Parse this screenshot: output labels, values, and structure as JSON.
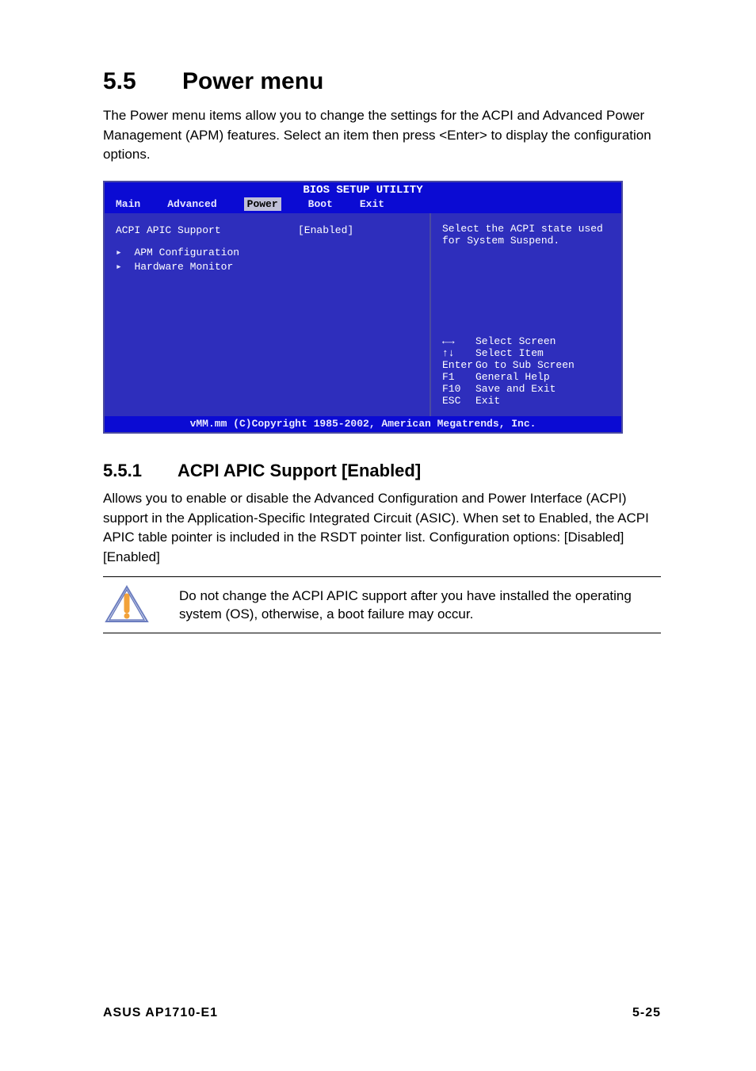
{
  "heading": {
    "number": "5.5",
    "title": "Power menu"
  },
  "intro": "The Power menu items allow you to change the settings for the ACPI and Advanced Power Management (APM) features. Select an item then press <Enter> to display the configuration options.",
  "bios": {
    "title": "BIOS SETUP UTILITY",
    "tabs": [
      "Main",
      "Advanced",
      "Power",
      "Boot",
      "Exit"
    ],
    "active_tab_index": 2,
    "items": [
      {
        "label": "ACPI APIC Support",
        "value": "[Enabled]",
        "submenu": false
      },
      {
        "label": "APM Configuration",
        "value": "",
        "submenu": true
      },
      {
        "label": "Hardware Monitor",
        "value": "",
        "submenu": true
      }
    ],
    "help_text": "Select the ACPI state used for System Suspend.",
    "keys": [
      {
        "sym": "←→",
        "label": "Select Screen"
      },
      {
        "sym": "↑↓",
        "label": "Select Item"
      },
      {
        "sym": "Enter",
        "label": "Go to Sub Screen"
      },
      {
        "sym": "F1",
        "label": "General Help"
      },
      {
        "sym": "F10",
        "label": "Save and Exit"
      },
      {
        "sym": "ESC",
        "label": "Exit"
      }
    ],
    "footer": "vMM.mm (C)Copyright 1985-2002, American Megatrends, Inc."
  },
  "subsection": {
    "number": "5.5.1",
    "title": "ACPI APIC Support [Enabled]",
    "body": "Allows you to enable or disable the Advanced Configuration and Power Interface (ACPI) support in the Application-Specific Integrated Circuit (ASIC). When set to Enabled, the ACPI APIC table pointer is included in the RSDT pointer list. Configuration options: [Disabled] [Enabled]"
  },
  "note": "Do not change the ACPI APIC support after you have installed the operating system (OS), otherwise, a boot failure may occur.",
  "footer": {
    "left": "ASUS AP1710-E1",
    "right": "5-25"
  }
}
